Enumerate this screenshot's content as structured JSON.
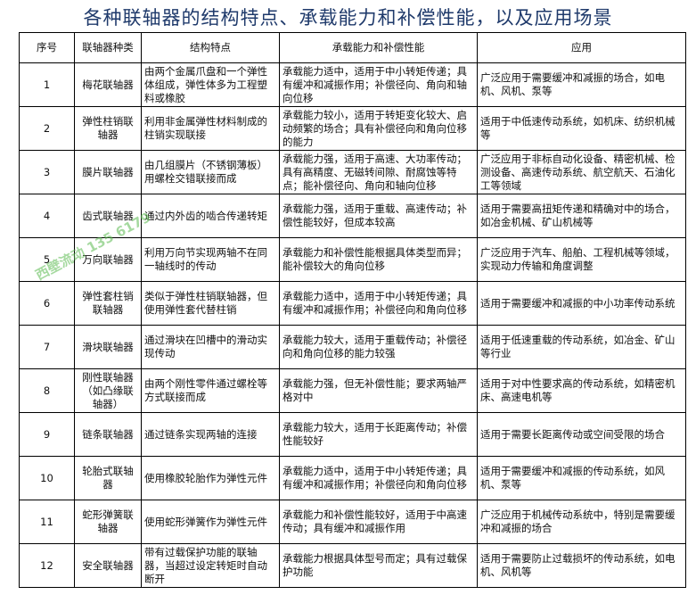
{
  "title": "各种联轴器的结构特点、承载能力和补偿性能，以及应用场景",
  "headers": [
    "序号",
    "联轴器种类",
    "结构特点",
    "承载能力和补偿性能",
    "应用"
  ],
  "rows": [
    [
      "1",
      "梅花联轴器",
      "由两个金属爪盘和一个弹性体组成，弹性体多为工程塑料或橡胶",
      "承载能力适中，适用于中小转矩传递；具有缓冲和减振作用；补偿径向、角向和轴向位移",
      "广泛应用于需要缓冲和减振的场合，如电机、风机、泵等"
    ],
    [
      "2",
      "弹性柱销联轴器",
      "利用非金属弹性材料制成的柱销实现联接",
      "承载能力较小，适用于转矩变化较大、启动频繁的场合；具有补偿径向和角向位移的能力",
      "适用于中低速传动系统，如机床、纺织机械等"
    ],
    [
      "3",
      "膜片联轴器",
      "由几组膜片（不锈钢薄板）用螺栓交错联接而成",
      "承载能力强，适用于高速、大功率传动；具有高精度、无磁转间隙、耐腐蚀等特点；能补偿径向、角向和轴向位移",
      "广泛应用于非标自动化设备、精密机械、检测设备、高速传动系统、航空航天、石油化工等领域"
    ],
    [
      "4",
      "齿式联轴器",
      "通过内外齿的啮合传递转矩",
      "承载能力强，适用于重载、高速传动；补偿性能较好，但成本较高",
      "适用于需要高扭矩传递和精确对中的场合，如冶金机械、矿山机械等"
    ],
    [
      "5",
      "万向联轴器",
      "利用万向节实现两轴不在同一轴线时的传动",
      "承载能力和补偿性能根据具体类型而异；能补偿较大的角向位移",
      "广泛应用于汽车、船舶、工程机械等领域，实现动力传输和角度调整"
    ],
    [
      "6",
      "弹性套柱销联轴器",
      "类似于弹性柱销联轴器，但使用弹性套代替柱销",
      "承载能力适中，适用于中小转矩传递；具有缓冲和减振作用；补偿径向和角向位移",
      "适用于需要缓冲和减振的中小功率传动系统"
    ],
    [
      "7",
      "滑块联轴器",
      "通过滑块在凹槽中的滑动实现传动",
      "承载能力较大，适用于重载传动；补偿径向和角向位移的能力较强",
      "适用于低速重载的传动系统，如冶金、矿山等行业"
    ],
    [
      "8",
      "刚性联轴器（如凸缘联轴器）",
      "由两个刚性零件通过螺栓等方式联接而成",
      "承载能力强，但无补偿性能；要求两轴严格对中",
      "适用于对中性要求高的传动系统，如精密机床、高速电机等"
    ],
    [
      "9",
      "链条联轴器",
      "通过链条实现两轴的连接",
      "承载能力较大，适用于长距离传动；补偿性能较好",
      "适用于需要长距离传动或空间受限的场合"
    ],
    [
      "10",
      "轮胎式联轴器",
      "使用橡胶轮胎作为弹性元件",
      "承载能力适中，适用于中小转矩传递；具有缓冲和减振作用；补偿径向和角向位移",
      "适用于需要缓冲和减振的传动系统，如风机、泵等"
    ],
    [
      "11",
      "蛇形弹簧联轴器",
      "使用蛇形弹簧作为弹性元件",
      "承载能力和补偿性能较好，适用于中高速传动；具有缓冲和减振作用",
      "广泛应用于机械传动系统中，特别是需要缓冲和减振的场合"
    ],
    [
      "12",
      "安全联轴器",
      "带有过载保护功能的联轴器，当超过设定转矩时自动断开",
      "承载能力根据具体型号而定；具有过载保护功能",
      "适用于需要防止过载损坏的传动系统，如电机、风机等"
    ]
  ],
  "watermark": "西壁流动 135     6179"
}
